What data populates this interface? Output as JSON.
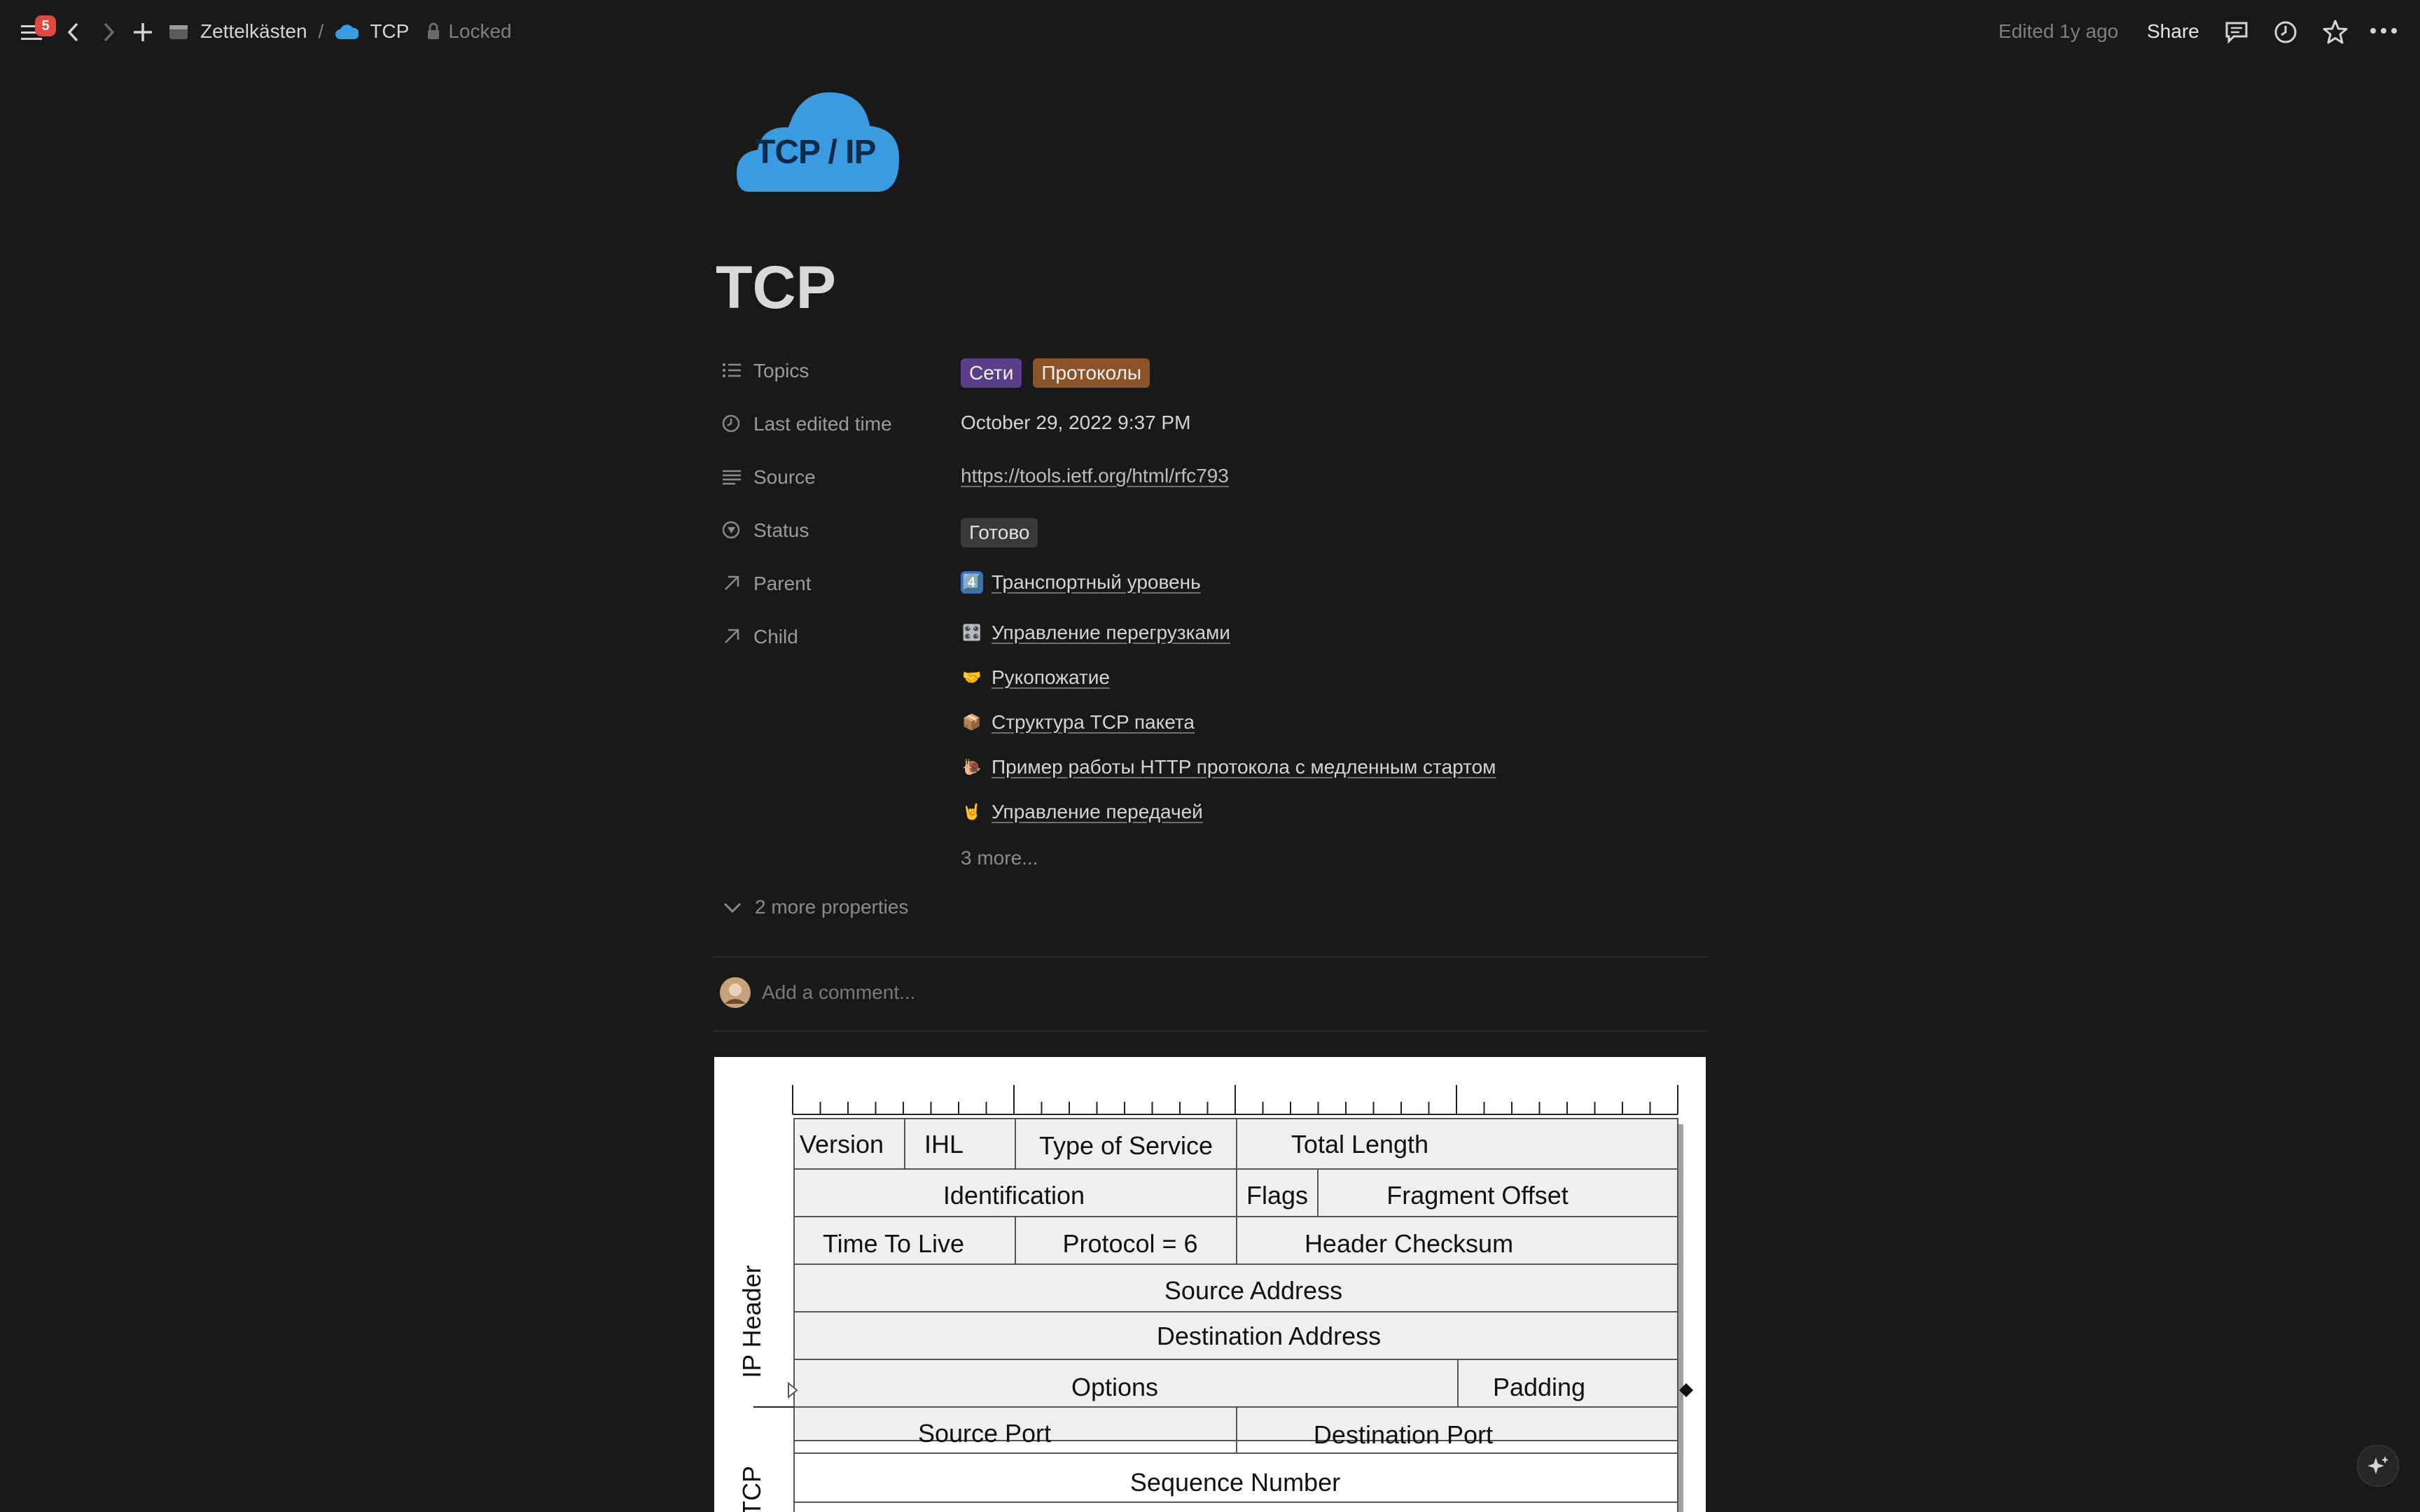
{
  "topbar": {
    "notification_count": "5",
    "breadcrumb": [
      {
        "label": "Zettelkästen"
      },
      {
        "label": "TCP"
      }
    ],
    "separator": "/",
    "locked_label": "Locked",
    "edited_label": "Edited 1y ago",
    "share_label": "Share"
  },
  "page": {
    "icon_text": "TCP / IP",
    "icon_color": "#3a9be0",
    "title": "TCP"
  },
  "properties": {
    "topics": {
      "label": "Topics",
      "tags": [
        {
          "text": "Сети",
          "color": "#5a3e8a"
        },
        {
          "text": "Протоколы",
          "color": "#8a5428"
        }
      ]
    },
    "last_edited": {
      "label": "Last edited time",
      "value": "October 29, 2022 9:37 PM"
    },
    "source": {
      "label": "Source",
      "value": "https://tools.ietf.org/html/rfc793"
    },
    "status": {
      "label": "Status",
      "value": "Готово",
      "color": "#3a3a3a"
    },
    "parent": {
      "label": "Parent",
      "emoji": "4️⃣",
      "value": "Транспортный уровень"
    },
    "child": {
      "label": "Child",
      "items": [
        {
          "emoji": "🎛️",
          "text": "Управление перегрузками"
        },
        {
          "emoji": "🤝",
          "text": "Рукопожатие"
        },
        {
          "emoji": "📦",
          "text": "Структура TCP пакета"
        },
        {
          "emoji": "🐌",
          "text": "Пример работы HTTP протокола с медленным стартом"
        },
        {
          "emoji": "🤘",
          "text": "Управление передачей"
        }
      ],
      "more": "3 more..."
    },
    "more_properties": "2 more properties"
  },
  "comment": {
    "placeholder": "Add a comment..."
  },
  "diagram": {
    "ip_header_label": "IP Header",
    "tcp_label": "TCP",
    "rows": [
      [
        "Version",
        "IHL",
        "Type of Service",
        "Total Length"
      ],
      [
        "Identification",
        "Flags",
        "Fragment Offset"
      ],
      [
        "Time To Live",
        "Protocol = 6",
        "Header Checksum"
      ],
      [
        "Source Address"
      ],
      [
        "Destination Address"
      ],
      [
        "Options",
        "Padding"
      ],
      [
        "Source Port",
        "Destination Port"
      ],
      [
        "Sequence Number"
      ]
    ]
  }
}
